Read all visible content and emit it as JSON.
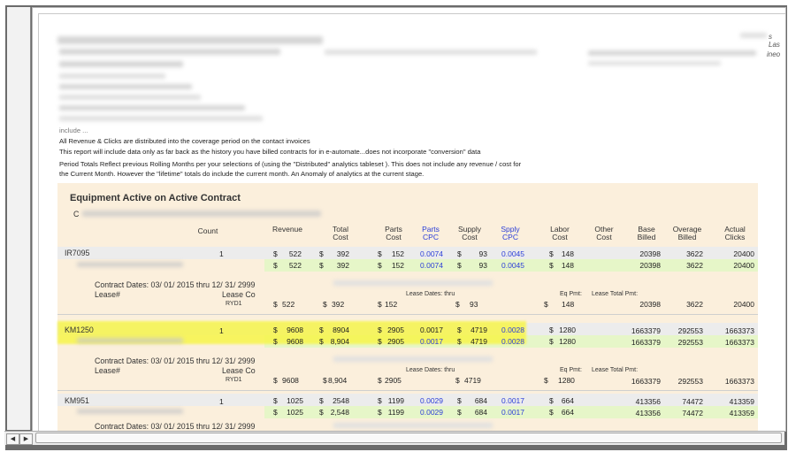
{
  "intro": {
    "include_text": "include ...",
    "line1": "All Revenue & Clicks are distributed into the coverage period on the contact invoices",
    "line2": "This report will include data only as far back as the history you have billed contracts for in e-automate...does not incorporate \"conversion\" data",
    "line3": "Period Totals Reflect previous Rolling Months  per your selections of  (using the  \"Distributed\" analytics tableset ).  This does not include any revenue / cost for",
    "line4": "the Current Month.   However the  \"lifetime\" totals do include the current month.   An Anomaly of analytics at the current stage.",
    "right_cut1": "s Las",
    "right_cut2": "ineo"
  },
  "section": {
    "title": "Equipment Active on Active Contract",
    "sub_initial": "C"
  },
  "headers": {
    "count": "Count",
    "revenue": "Revenue",
    "total_cost": "Total\nCost",
    "parts_cost": "Parts\nCost",
    "parts_cpc": "Parts\nCPC",
    "supply_cost": "Supply\nCost",
    "spply_cpc": "Spply\nCPC",
    "labor_cost": "Labor\nCost",
    "other_cost": "Other\nCost",
    "base_billed": "Base\nBilled",
    "overage_billed": "Overage\nBilled",
    "actual_clicks": "Actual\nClicks"
  },
  "groups": [
    {
      "model": "IR7095",
      "count": "1",
      "row1": {
        "revenue": "522",
        "total_cost": "392",
        "parts_cost": "152",
        "parts_cpc": "0.0074",
        "supply_cost": "93",
        "spply_cpc": "0.0045",
        "labor_cost": "148",
        "base": "20398",
        "overage": "3622",
        "clicks": "20400"
      },
      "row2": {
        "revenue": "522",
        "total_cost": "392",
        "parts_cost": "152",
        "parts_cpc": "0.0074",
        "supply_cost": "93",
        "spply_cpc": "0.0045",
        "labor_cost": "148",
        "base": "20398",
        "overage": "3622",
        "clicks": "20400"
      },
      "contract_dates": "Contract Dates: 03/ 01/ 2015 thru 12/ 31/ 2999",
      "lease_label": "Lease#",
      "lease_co_label": "Lease Co",
      "lease_dates_label": "Lease Dates: thru",
      "eq_pmt_label": "Eq Pmt:",
      "lease_total_label": "Lease Total Pmt:",
      "lease_co": "RYD1",
      "row3": {
        "revenue": "522",
        "total_cost": "392",
        "parts_cost": "152",
        "supply_cost": "93",
        "labor_cost": "148",
        "base": "20398",
        "overage": "3622",
        "clicks": "20400"
      }
    },
    {
      "model": "KM1250",
      "count": "1",
      "row1": {
        "revenue": "9608",
        "total_cost": "8904",
        "parts_cost": "2905",
        "parts_cpc": "0.0017",
        "supply_cost": "4719",
        "spply_cpc": "0.0028",
        "labor_cost": "1280",
        "base": "1663379",
        "overage": "292553",
        "clicks": "1663373"
      },
      "row2": {
        "revenue": "9608",
        "total_cost": "8,904",
        "parts_cost": "2905",
        "parts_cpc": "0.0017",
        "supply_cost": "4719",
        "spply_cpc": "0.0028",
        "labor_cost": "1280",
        "base": "1663379",
        "overage": "292553",
        "clicks": "1663373"
      },
      "contract_dates": "Contract Dates: 03/ 01/ 2015 thru 12/ 31/ 2999",
      "lease_label": "Lease#",
      "lease_co_label": "Lease Co",
      "lease_dates_label": "Lease Dates: thru",
      "eq_pmt_label": "Eq Pmt:",
      "lease_total_label": "Lease Total Pmt:",
      "lease_co": "RYD1",
      "row3": {
        "revenue": "9608",
        "total_cost": "8,904",
        "parts_cost": "2905",
        "supply_cost": "4719",
        "labor_cost": "1280",
        "base": "1663379",
        "overage": "292553",
        "clicks": "1663373"
      }
    },
    {
      "model": "KM951",
      "count": "1",
      "row1": {
        "revenue": "1025",
        "total_cost": "2548",
        "parts_cost": "1199",
        "parts_cpc": "0.0029",
        "supply_cost": "684",
        "spply_cpc": "0.0017",
        "labor_cost": "664",
        "base": "413356",
        "overage": "74472",
        "clicks": "413359"
      },
      "row2": {
        "revenue": "1025",
        "total_cost": "2,548",
        "parts_cost": "1199",
        "parts_cpc": "0.0029",
        "supply_cost": "684",
        "spply_cpc": "0.0017",
        "labor_cost": "664",
        "base": "413356",
        "overage": "74472",
        "clicks": "413359"
      },
      "contract_dates": "Contract Dates: 03/ 01/ 2015 thru 12/ 31/ 2999"
    }
  ],
  "currency": "$",
  "scrollbar": {
    "left_arrow": "◀",
    "right_arrow": "▶"
  },
  "colors": {
    "highlight": "#f7f54a",
    "section_bg": "#fbefdc",
    "green_band": "#e6f6c8",
    "cpc_blue": "#2b3ed8"
  }
}
